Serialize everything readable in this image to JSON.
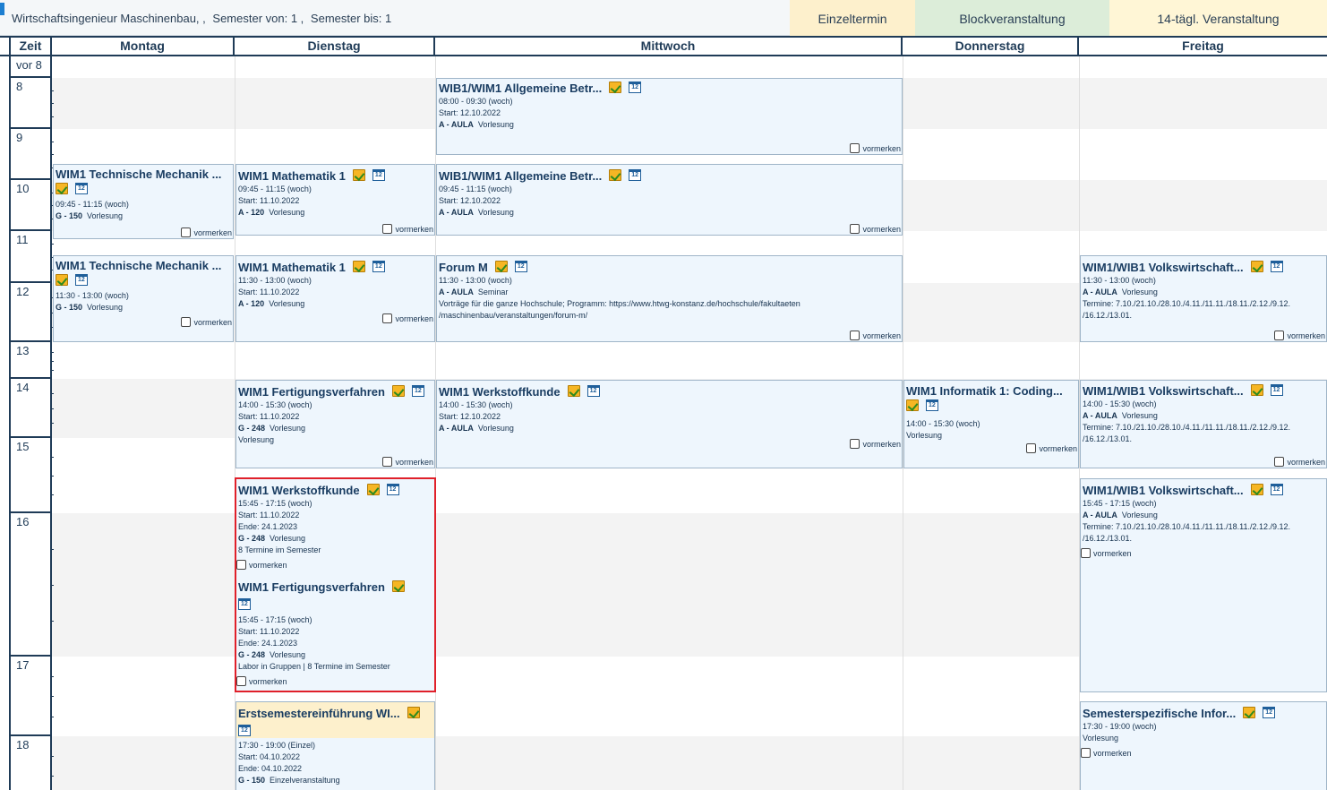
{
  "header": {
    "study_program": "Wirtschaftsingenieur Maschinenbau, ,",
    "semester_from": "Semester von: 1 ,",
    "semester_to": "Semester bis: 1"
  },
  "legend": {
    "einzeltermin": "Einzeltermin",
    "blockveranstaltung": "Blockveranstaltung",
    "biweekly": "14-tägl. Veranstaltung",
    "colors": {
      "einzeltermin": "#fdf0cc",
      "blockveranstaltung": "#dcedd9",
      "biweekly": "#fff6d6"
    }
  },
  "columns": {
    "time": "Zeit",
    "mon": "Montag",
    "tue": "Dienstag",
    "wed": "Mittwoch",
    "thu": "Donnerstag",
    "fri": "Freitag"
  },
  "times": {
    "before": "vor 8",
    "h8": "8",
    "h9": "9",
    "h10": "10",
    "h11": "11",
    "h12": "12",
    "h13": "13",
    "h14": "14",
    "h15": "15",
    "h16": "16",
    "h17": "17",
    "h18": "18"
  },
  "bookmark_label": "vormerken",
  "events": {
    "wed1": {
      "title": "WIB1/WIM1 Allgemeine Betr...",
      "time": "08:00 - 09:30 (woch)",
      "start": "Start: 12.10.2022",
      "room": "A - AULA",
      "type": "Vorlesung"
    },
    "mon1": {
      "title": "WIM1 Technische Mechanik ...",
      "time": "09:45 - 11:15 (woch)",
      "room": "G - 150",
      "type": "Vorlesung"
    },
    "tue1": {
      "title": "WIM1 Mathematik 1",
      "time": "09:45 - 11:15 (woch)",
      "start": "Start: 11.10.2022",
      "room": "A - 120",
      "type": "Vorlesung"
    },
    "wed2": {
      "title": "WIB1/WIM1 Allgemeine Betr...",
      "time": "09:45 - 11:15 (woch)",
      "start": "Start: 12.10.2022",
      "room": "A - AULA",
      "type": "Vorlesung"
    },
    "mon2": {
      "title": "WIM1 Technische Mechanik ...",
      "time": "11:30 - 13:00 (woch)",
      "room": "G - 150",
      "type": "Vorlesung"
    },
    "tue2": {
      "title": "WIM1 Mathematik 1",
      "time": "11:30 - 13:00 (woch)",
      "start": "Start: 11.10.2022",
      "room": "A - 120",
      "type": "Vorlesung"
    },
    "wed3": {
      "title": "Forum M",
      "time": "11:30 - 13:00 (woch)",
      "room": "A - AULA",
      "type": "Seminar",
      "note": "Vorträge für die ganze Hochschule; Programm: https://www.htwg-konstanz.de/hochschule/fakultaeten /maschinenbau/veranstaltungen/forum-m/"
    },
    "fri1": {
      "title": "WIM1/WIB1 Volkswirtschaft...",
      "time": "11:30 - 13:00 (woch)",
      "room": "A - AULA",
      "type": "Vorlesung",
      "dates": "Termine: 7.10./21.10./28.10./4.11./11.11./18.11./2.12./9.12. /16.12./13.01."
    },
    "tue3": {
      "title": "WIM1 Fertigungsverfahren",
      "time": "14:00 - 15:30 (woch)",
      "start": "Start: 11.10.2022",
      "room": "G - 248",
      "type": "Vorlesung",
      "extra": "Vorlesung"
    },
    "wed4": {
      "title": "WIM1 Werkstoffkunde",
      "time": "14:00 - 15:30 (woch)",
      "start": "Start: 12.10.2022",
      "room": "A - AULA",
      "type": "Vorlesung"
    },
    "thu1": {
      "title": "WIM1 Informatik 1: Coding...",
      "time": "14:00 - 15:30 (woch)",
      "type": "Vorlesung"
    },
    "fri2": {
      "title": "WIM1/WIB1 Volkswirtschaft...",
      "time": "14:00 - 15:30 (woch)",
      "room": "A - AULA",
      "type": "Vorlesung",
      "dates": "Termine: 7.10./21.10./28.10./4.11./11.11./18.11./2.12./9.12. /16.12./13.01."
    },
    "tue4a": {
      "title": "WIM1 Werkstoffkunde",
      "time": "15:45 - 17:15 (woch)",
      "start": "Start: 11.10.2022",
      "end": "Ende: 24.1.2023",
      "room": "G - 248",
      "type": "Vorlesung",
      "note": "8 Termine im Semester"
    },
    "tue4b": {
      "title": "WIM1 Fertigungsverfahren",
      "time": "15:45 - 17:15 (woch)",
      "start": "Start: 11.10.2022",
      "end": "Ende: 24.1.2023",
      "room": "G - 248",
      "type": "Vorlesung",
      "note": "Labor in Gruppen | 8 Termine im Semester"
    },
    "fri3": {
      "title": "WIM1/WIB1 Volkswirtschaft...",
      "time": "15:45 - 17:15 (woch)",
      "room": "A - AULA",
      "type": "Vorlesung",
      "dates": "Termine: 7.10./21.10./28.10./4.11./11.11./18.11./2.12./9.12. /16.12./13.01."
    },
    "tue5": {
      "title": "Erstsemestereinführung WI...",
      "time": "17:30 - 19:00 (Einzel)",
      "start": "Start: 04.10.2022",
      "end": "Ende: 04.10.2022",
      "room": "G - 150",
      "type": "Einzelveranstaltung"
    },
    "fri4": {
      "title": "Semesterspezifische Infor...",
      "time": "17:30 - 19:00 (woch)",
      "type": "Vorlesung"
    }
  }
}
